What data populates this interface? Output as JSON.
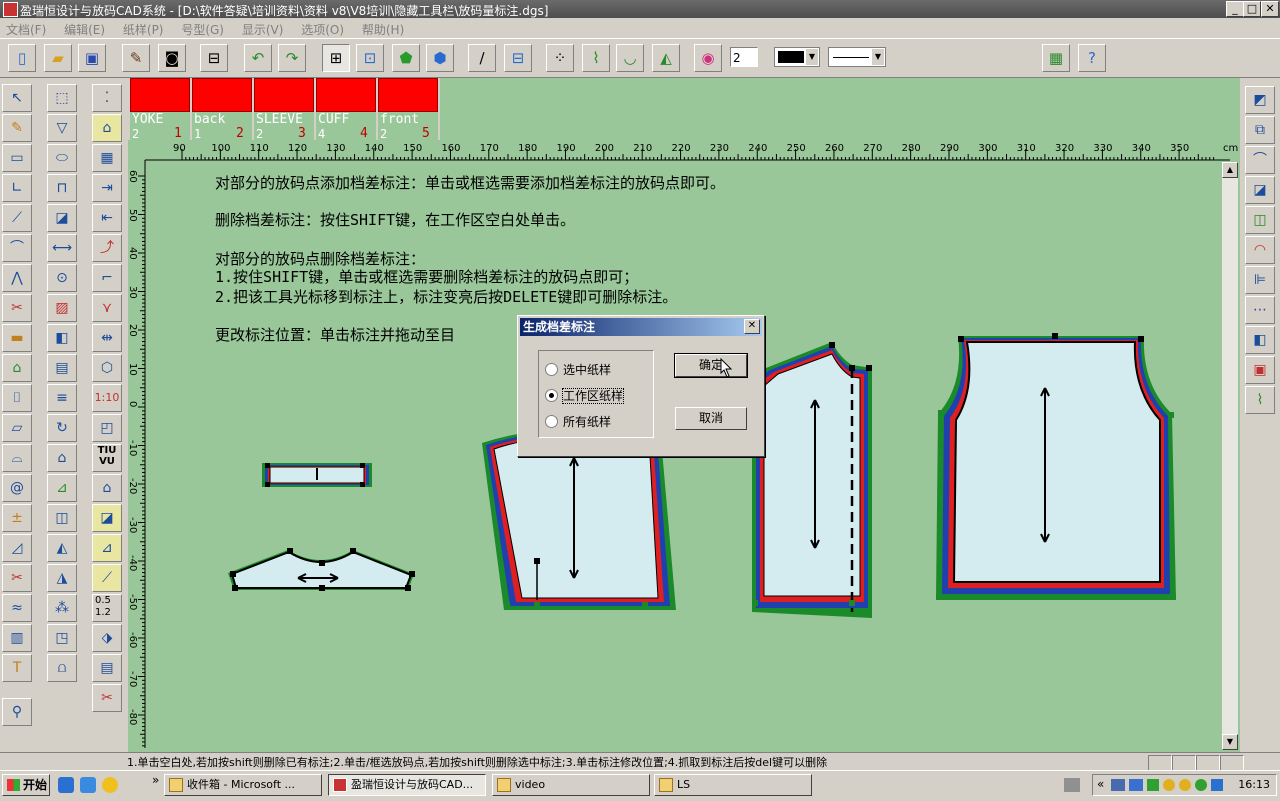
{
  "window": {
    "title": "盈瑞恒设计与放码CAD系统 - [D:\\软件答疑\\培训资料\\资料 v8\\V8培训\\隐藏工具栏\\放码量标注.dgs]",
    "min": "_",
    "max": "□",
    "close": "✕"
  },
  "menu": [
    "文档(F)",
    "编辑(E)",
    "纸样(P)",
    "号型(G)",
    "显示(V)",
    "选项(O)",
    "帮助(H)"
  ],
  "toolbar": {
    "line_width_value": "2",
    "colors": {
      "accent_blue": "#1c4c9c",
      "canvas": "#99c799",
      "piece_fill": "#d4ecf0",
      "red": "#ff0000"
    }
  },
  "pieces": [
    {
      "name": "YOKE",
      "count": "2",
      "index": "1"
    },
    {
      "name": "back",
      "count": "1",
      "index": "2"
    },
    {
      "name": "SLEEVE",
      "count": "2",
      "index": "3"
    },
    {
      "name": "CUFF",
      "count": "4",
      "index": "4"
    },
    {
      "name": "front",
      "count": "2",
      "index": "5"
    }
  ],
  "ruler": {
    "unit": "cm",
    "h": [
      "90",
      "100",
      "110",
      "120",
      "130",
      "140",
      "150",
      "160",
      "170",
      "180",
      "190",
      "200",
      "210",
      "220",
      "230",
      "240",
      "250",
      "260",
      "270",
      "280",
      "290",
      "300",
      "310",
      "320",
      "330",
      "340",
      "350"
    ],
    "v": [
      "60",
      "50",
      "40",
      "30",
      "20",
      "10",
      "0",
      "-10",
      "-20",
      "-30",
      "-40",
      "-50",
      "-60",
      "-70",
      "-80"
    ]
  },
  "notes": {
    "line1": "对部分的放码点添加档差标注：单击或框选需要添加档差标注的放码点即可。",
    "line2": "删除档差标注：按住SHIFT键，在工作区空白处单击。",
    "line3": "对部分的放码点删除档差标注：",
    "line4": "1.按住SHIFT键，单击或框选需要删除档差标注的放码点即可；",
    "line5": "2.把该工具光标移到标注上，标注变亮后按DELETE键即可删除标注。",
    "line6": "更改标注位置：单击标注并拖动至目"
  },
  "dialog": {
    "title": "生成档差标注",
    "close": "✕",
    "options": [
      "选中纸样",
      "工作区纸样",
      "所有纸样"
    ],
    "selected": 1,
    "ok": "确定",
    "cancel": "取消"
  },
  "left_tools": {
    "ratio_label": "1:10",
    "scale_a": "0.5",
    "scale_b": "1.2",
    "tuv": "TIU VU",
    "text_tool": "T"
  },
  "status": "1.单击空白处,若加按shift则删除已有标注;2.单击/框选放码点,若加按shift则删除选中标注;3.单击标注修改位置;4.抓取到标注后按del键可以删除",
  "taskbar": {
    "start": "开始",
    "tasks": [
      "收件箱 - Microsoft ...",
      "盈瑞恒设计与放码CAD...",
      "video",
      "LS"
    ],
    "clock": "16:13",
    "chevron": "«"
  }
}
